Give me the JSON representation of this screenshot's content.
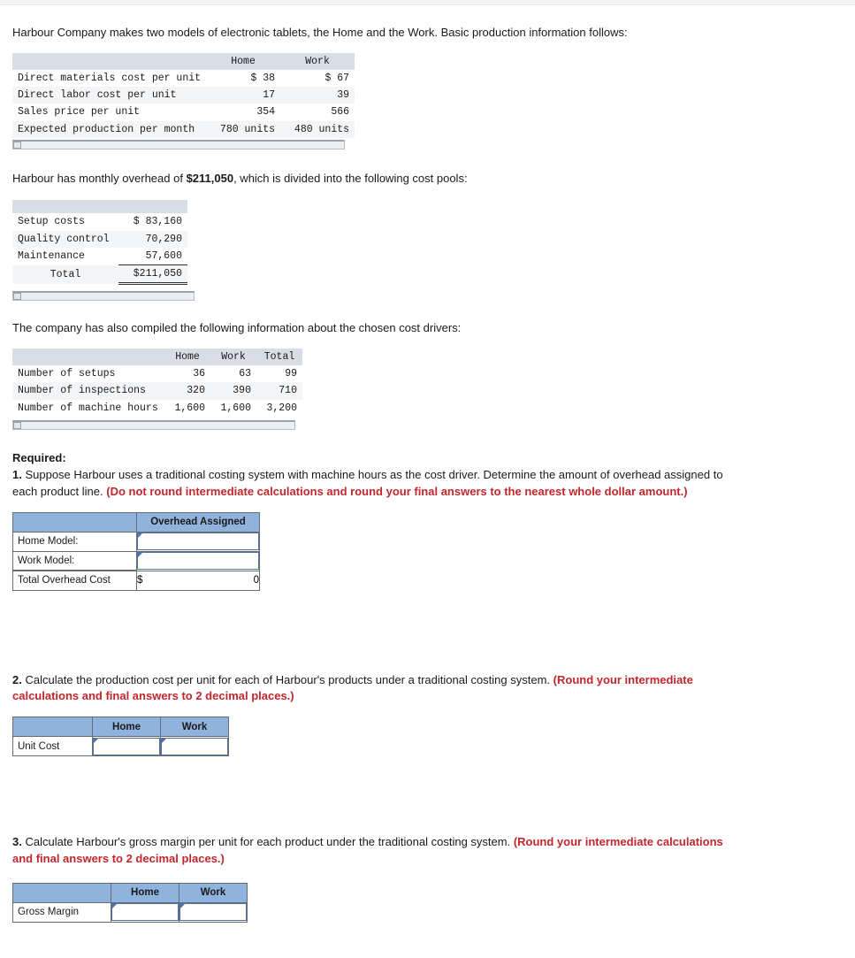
{
  "intro": {
    "paragraph1": "Harbour Company makes two models of electronic tablets, the Home and the Work. Basic production information follows:",
    "paragraph2_pre": "Harbour has monthly overhead of ",
    "paragraph2_amount": "$211,050",
    "paragraph2_post": ", which is divided into the following cost pools:",
    "paragraph3": "The company has also compiled the following information about the chosen cost drivers:"
  },
  "production_table": {
    "headers": [
      "",
      "Home",
      "Work"
    ],
    "rows": [
      {
        "label": "Direct materials cost per unit",
        "home": "$ 38",
        "work": "$ 67"
      },
      {
        "label": "Direct labor cost per unit",
        "home": "17",
        "work": "39"
      },
      {
        "label": "Sales price per unit",
        "home": "354",
        "work": "566"
      },
      {
        "label": "Expected production per month",
        "home": "780 units",
        "work": "480 units"
      }
    ]
  },
  "cost_pool_table": {
    "headers": [
      "",
      ""
    ],
    "rows": [
      {
        "label": "Setup costs",
        "value": "$ 83,160"
      },
      {
        "label": "Quality control",
        "value": "70,290"
      },
      {
        "label": "Maintenance",
        "value": "57,600"
      }
    ],
    "total_label": "Total",
    "total_value": "$211,050"
  },
  "cost_driver_table": {
    "headers": [
      "",
      "Home",
      "Work",
      "Total"
    ],
    "rows": [
      {
        "label": "Number of setups",
        "home": "36",
        "work": "63",
        "total": "99"
      },
      {
        "label": "Number of inspections",
        "home": "320",
        "work": "390",
        "total": "710"
      },
      {
        "label": "Number of machine hours",
        "home": "1,600",
        "work": "1,600",
        "total": "3,200"
      }
    ]
  },
  "required": {
    "heading": "Required:",
    "q1": {
      "number": "1.",
      "text": " Suppose Harbour uses a traditional costing system with machine hours as the cost driver. Determine the amount of overhead assigned to each product line. ",
      "note": "(Do not round intermediate calculations and round your final answers to the nearest whole dollar amount.)"
    },
    "q2": {
      "number": "2.",
      "text": " Calculate the production cost per unit for each of Harbour's products under a traditional costing system. ",
      "note": "(Round your intermediate calculations and final answers to 2 decimal places.)"
    },
    "q3": {
      "number": "3.",
      "text": " Calculate Harbour's gross margin per unit for each product under the traditional costing system. ",
      "note": "(Round your intermediate calculations and final answers to 2 decimal places.)"
    }
  },
  "answer1": {
    "col_header_blank": "",
    "col_header": "Overhead Assigned",
    "rows": [
      {
        "label": "Home Model:",
        "value": ""
      },
      {
        "label": "Work Model:",
        "value": ""
      }
    ],
    "total_label": "Total Overhead Cost",
    "total_currency": "$",
    "total_value": "0"
  },
  "answer2": {
    "col_header_blank": "",
    "col_headers": [
      "Home",
      "Work"
    ],
    "rows": [
      {
        "label": "Unit Cost",
        "home": "",
        "work": ""
      }
    ]
  },
  "answer3": {
    "col_header_blank": "",
    "col_headers": [
      "Home",
      "Work"
    ],
    "rows": [
      {
        "label": "Gross Margin",
        "home": "",
        "work": ""
      }
    ]
  },
  "colors": {
    "header_blue": "#8fb3dd",
    "field_border": "#4f73a8",
    "note_red": "#c1272d",
    "mono_header_gray": "#d9dde6"
  }
}
